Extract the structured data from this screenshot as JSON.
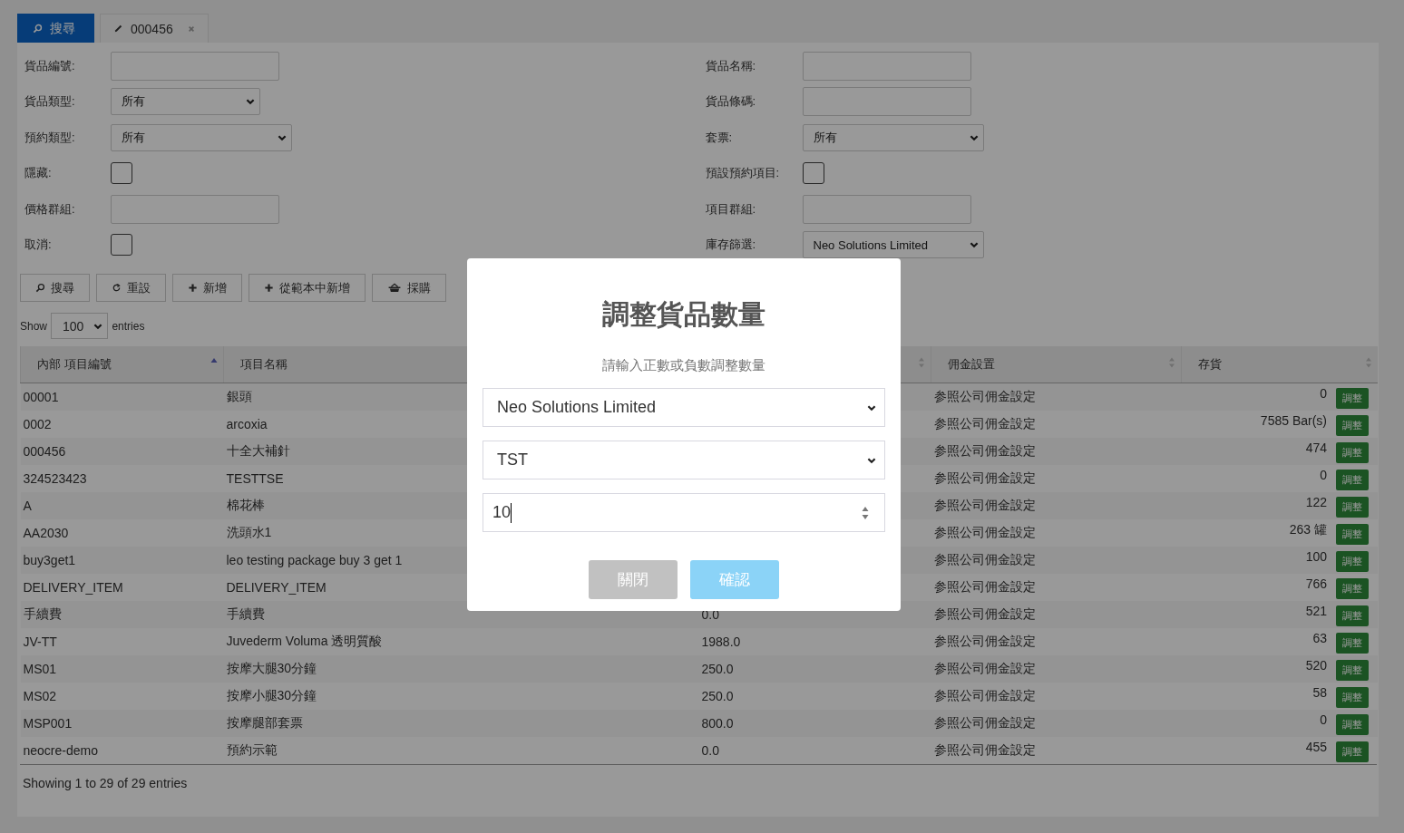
{
  "tabs": [
    {
      "label": "搜尋",
      "kind": "search",
      "selected": true,
      "closable": false
    },
    {
      "label": "000456",
      "kind": "edit",
      "selected": false,
      "closable": true
    }
  ],
  "form": {
    "left": [
      {
        "label": "貨品編號:",
        "kind": "text"
      },
      {
        "label": "貨品類型:",
        "kind": "select",
        "value": "所有"
      },
      {
        "label": "預約類型:",
        "kind": "select",
        "value": "所有"
      },
      {
        "label": "隱藏:",
        "kind": "checkbox",
        "checked": false
      },
      {
        "label": "價格群組:",
        "kind": "text"
      },
      {
        "label": "取消:",
        "kind": "checkbox",
        "checked": false
      }
    ],
    "right": [
      {
        "label": "貨品名稱:",
        "kind": "text"
      },
      {
        "label": "貨品條碼:",
        "kind": "text"
      },
      {
        "label": "套票:",
        "kind": "select",
        "value": "所有"
      },
      {
        "label": "預設預約項目:",
        "kind": "checkbox",
        "checked": false
      },
      {
        "label": "項目群組:",
        "kind": "text"
      },
      {
        "label": "庫存篩選:",
        "kind": "select",
        "value": "Neo Solutions Limited"
      }
    ]
  },
  "toolbar": [
    {
      "label": "搜尋",
      "kind": "search"
    },
    {
      "label": "重設",
      "kind": "reset"
    },
    {
      "label": "新增",
      "kind": "add"
    },
    {
      "label": "從範本中新增",
      "kind": "add"
    },
    {
      "label": "採購",
      "kind": "purchase"
    }
  ],
  "length_menu": {
    "before": "Show",
    "value": "100",
    "after": "entries"
  },
  "table": {
    "columns": [
      {
        "label": "內部 項目編號",
        "sorted": true
      },
      {
        "label": "項目名稱"
      },
      {
        "sorted": false
      },
      {
        "label": "佣金設置",
        "sorted": false
      },
      {
        "label": "存貨",
        "sorted": false
      }
    ],
    "rows": [
      {
        "code": "00001",
        "name": "銀頭",
        "commission": "参照公司佣金設定",
        "stock": "0",
        "action": "調整"
      },
      {
        "code": "0002",
        "name": "arcoxia",
        "commission": "参照公司佣金設定",
        "stock": "7585 Bar(s)",
        "action": "調整"
      },
      {
        "code": "000456",
        "name": "十全大補針",
        "commission": "参照公司佣金設定",
        "stock": "474",
        "action": "調整"
      },
      {
        "code": "324523423",
        "name": "TESTTSE",
        "commission": "参照公司佣金設定",
        "stock": "0",
        "action": "調整"
      },
      {
        "code": "A",
        "name": "棉花棒",
        "commission": "参照公司佣金設定",
        "stock": "122",
        "action": "調整"
      },
      {
        "code": "AA2030",
        "name": "洗頭水1",
        "commission": "参照公司佣金設定",
        "stock": "263 罐",
        "action": "調整"
      },
      {
        "code": "buy3get1",
        "name": "leo testing package buy 3 get 1",
        "commission": "参照公司佣金設定",
        "stock": "100",
        "action": "調整"
      },
      {
        "code": "DELIVERY_ITEM",
        "name": "DELIVERY_ITEM",
        "commission": "参照公司佣金設定",
        "stock": "766",
        "action": "調整"
      },
      {
        "code": "手續費",
        "name": "手續費",
        "price": "0.0",
        "commission": "参照公司佣金設定",
        "stock": "521",
        "action": "調整"
      },
      {
        "code": "JV-TT",
        "name": "Juvederm Voluma 透明質酸",
        "price": "1988.0",
        "commission": "参照公司佣金設定",
        "stock": "63",
        "action": "調整"
      },
      {
        "code": "MS01",
        "name": "按摩大腿30分鐘",
        "price": "250.0",
        "commission": "参照公司佣金設定",
        "stock": "520",
        "action": "調整"
      },
      {
        "code": "MS02",
        "name": "按摩小腿30分鐘",
        "price": "250.0",
        "commission": "参照公司佣金設定",
        "stock": "58",
        "action": "調整"
      },
      {
        "code": "MSP001",
        "name": "按摩腿部套票",
        "price": "800.0",
        "commission": "参照公司佣金設定",
        "stock": "0",
        "action": "調整"
      },
      {
        "code": "neocre-demo",
        "name": "預約示範",
        "price": "0.0",
        "commission": "参照公司佣金設定",
        "stock": "455",
        "action": "調整"
      }
    ],
    "info": "Showing 1 to 29 of 29 entries"
  },
  "modal": {
    "title": "調整貨品數量",
    "subtitle": "請輸入正數或負數調整數量",
    "selects": [
      "Neo Solutions Limited",
      "TST"
    ],
    "quantity": "10",
    "buttons": [
      {
        "label": "關閉",
        "kind": "close"
      },
      {
        "label": "確認",
        "kind": "confirm"
      }
    ]
  }
}
